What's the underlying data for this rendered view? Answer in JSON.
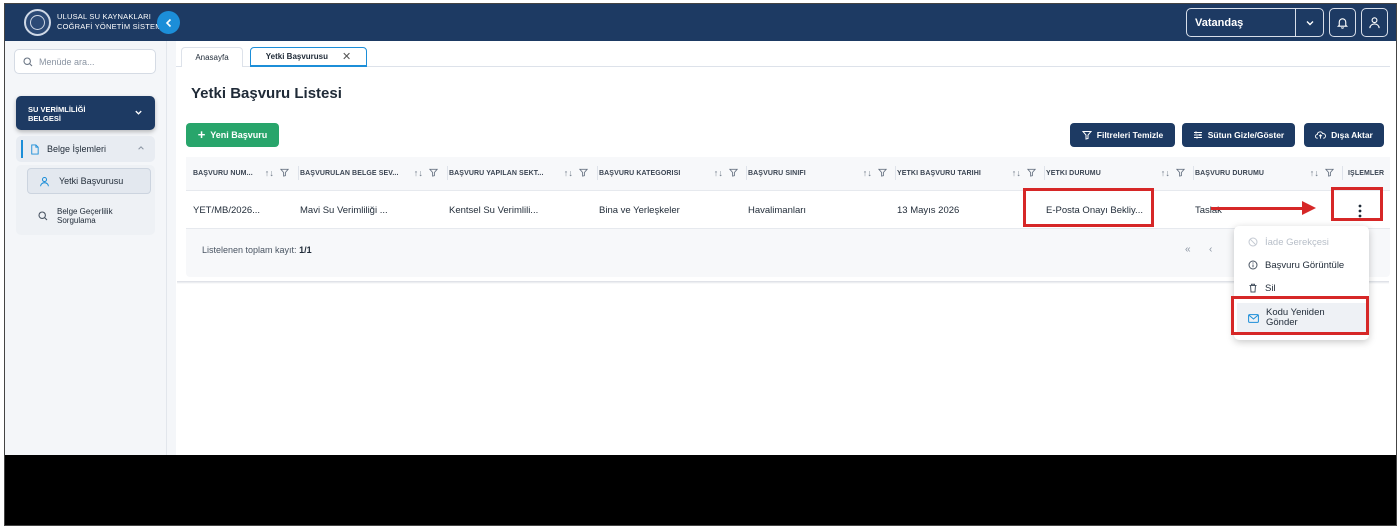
{
  "header": {
    "logo_line1": "ULUSAL SU KAYNAKLARI",
    "logo_line2": "COĞRAFİ YÖNETİM SİSTEMİ",
    "role_value": "Vatandaş"
  },
  "sidebar": {
    "search_placeholder": "Menüde ara...",
    "section_title_line1": "SU VERİMLİLİĞİ",
    "section_title_line2": "BELGESİ",
    "group_label": "Belge İşlemleri",
    "items": [
      {
        "label": "Yetki Başvurusu"
      },
      {
        "label_line1": "Belge Geçerlilik",
        "label_line2": "Sorgulama"
      }
    ]
  },
  "tabs": [
    {
      "label": "Anasayfa"
    },
    {
      "label": "Yetki Başvurusu"
    }
  ],
  "page": {
    "title": "Yetki Başvuru Listesi",
    "new_button": "Yeni Başvuru",
    "clear_filters_button": "Filtreleri Temizle",
    "columns_button": "Sütun Gizle/Göster",
    "export_button": "Dışa Aktar"
  },
  "table": {
    "headers": [
      "BAŞVURU NUM...",
      "BAŞVURULAN BELGE SEV...",
      "BAŞVURU YAPILAN SEKT...",
      "BAŞVURU KATEGORİSİ",
      "BAŞVURU SINIFI",
      "YETKİ BAŞVURU TARİHİ",
      "YETKİ DURUMU",
      "BAŞVURU DURUMU",
      "İŞLEMLER"
    ],
    "rows": [
      [
        "YET/MB/2026...",
        "Mavi Su Verimliliği ...",
        "Kentsel Su Verimlili...",
        "Bina ve Yerleşkeler",
        "Havalimanları",
        "13 Mayıs 2026",
        "E-Posta Onayı Bekliy...",
        "Taslak"
      ]
    ],
    "footer_label": "Listelenen toplam kayıt:",
    "footer_count": "1/1",
    "pager_first": "«",
    "pager_prev": "‹"
  },
  "context_menu": {
    "items": [
      {
        "label": "İade Gerekçesi",
        "disabled": true
      },
      {
        "label": "Başvuru Görüntüle"
      },
      {
        "label": "Sil"
      },
      {
        "label_line1": "Kodu Yeniden",
        "label_line2": "Gönder"
      }
    ]
  },
  "colors": {
    "primary_navy": "#1d3a63",
    "accent_blue": "#1c8ed8",
    "success_green": "#28a56b",
    "highlight_red": "#d62727"
  }
}
